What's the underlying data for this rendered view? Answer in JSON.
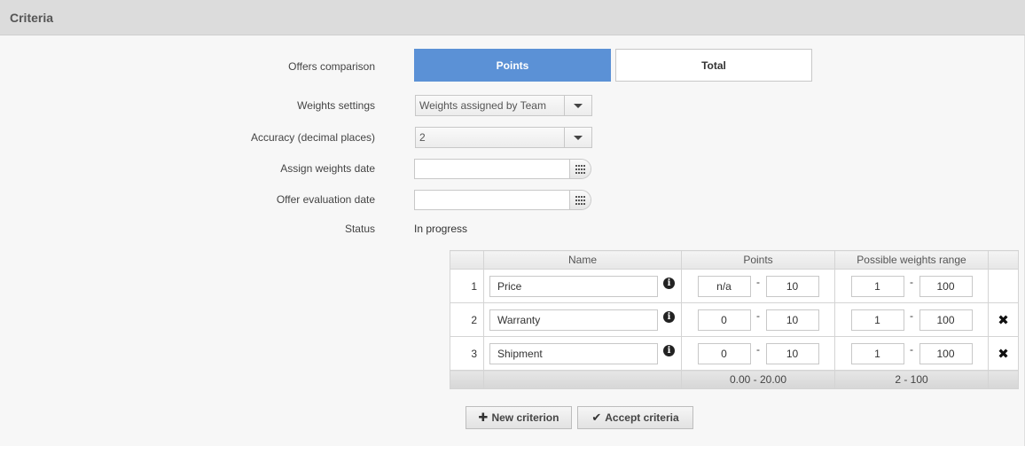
{
  "panel": {
    "title": "Criteria"
  },
  "form": {
    "offers_comparison": {
      "label": "Offers comparison",
      "options": [
        "Points",
        "Total"
      ],
      "selected": "Points"
    },
    "weights_settings": {
      "label": "Weights settings",
      "value": "Weights assigned by Team"
    },
    "accuracy": {
      "label": "Accuracy (decimal places)",
      "value": "2"
    },
    "assign_weights_date": {
      "label": "Assign weights date",
      "value": ""
    },
    "offer_evaluation_date": {
      "label": "Offer evaluation date",
      "value": ""
    },
    "status": {
      "label": "Status",
      "value": "In progress"
    }
  },
  "table": {
    "headers": [
      "Name",
      "Points",
      "Possible weights range"
    ],
    "rows": [
      {
        "num": "1",
        "name": "Price",
        "points_min": "n/a",
        "points_max": "10",
        "range_min": "1",
        "range_max": "100",
        "deletable": false
      },
      {
        "num": "2",
        "name": "Warranty",
        "points_min": "0",
        "points_max": "10",
        "range_min": "1",
        "range_max": "100",
        "deletable": true
      },
      {
        "num": "3",
        "name": "Shipment",
        "points_min": "0",
        "points_max": "10",
        "range_min": "1",
        "range_max": "100",
        "deletable": true
      }
    ],
    "footer": {
      "points_total": "0.00 - 20.00",
      "range_total": "2 - 100"
    },
    "dash": "-"
  },
  "actions": {
    "new_criterion": "New criterion",
    "accept_criteria": "Accept criteria"
  },
  "icons": {
    "info": "info-circle-icon",
    "delete": "close-x-icon",
    "calendar": "calendar-icon",
    "dropdown": "chevron-down-icon",
    "plus": "plus-icon",
    "check": "check-icon"
  },
  "colors": {
    "accent": "#5b91d6",
    "header_bg": "#dcdcdc",
    "panel_bg": "#f7f7f7"
  }
}
